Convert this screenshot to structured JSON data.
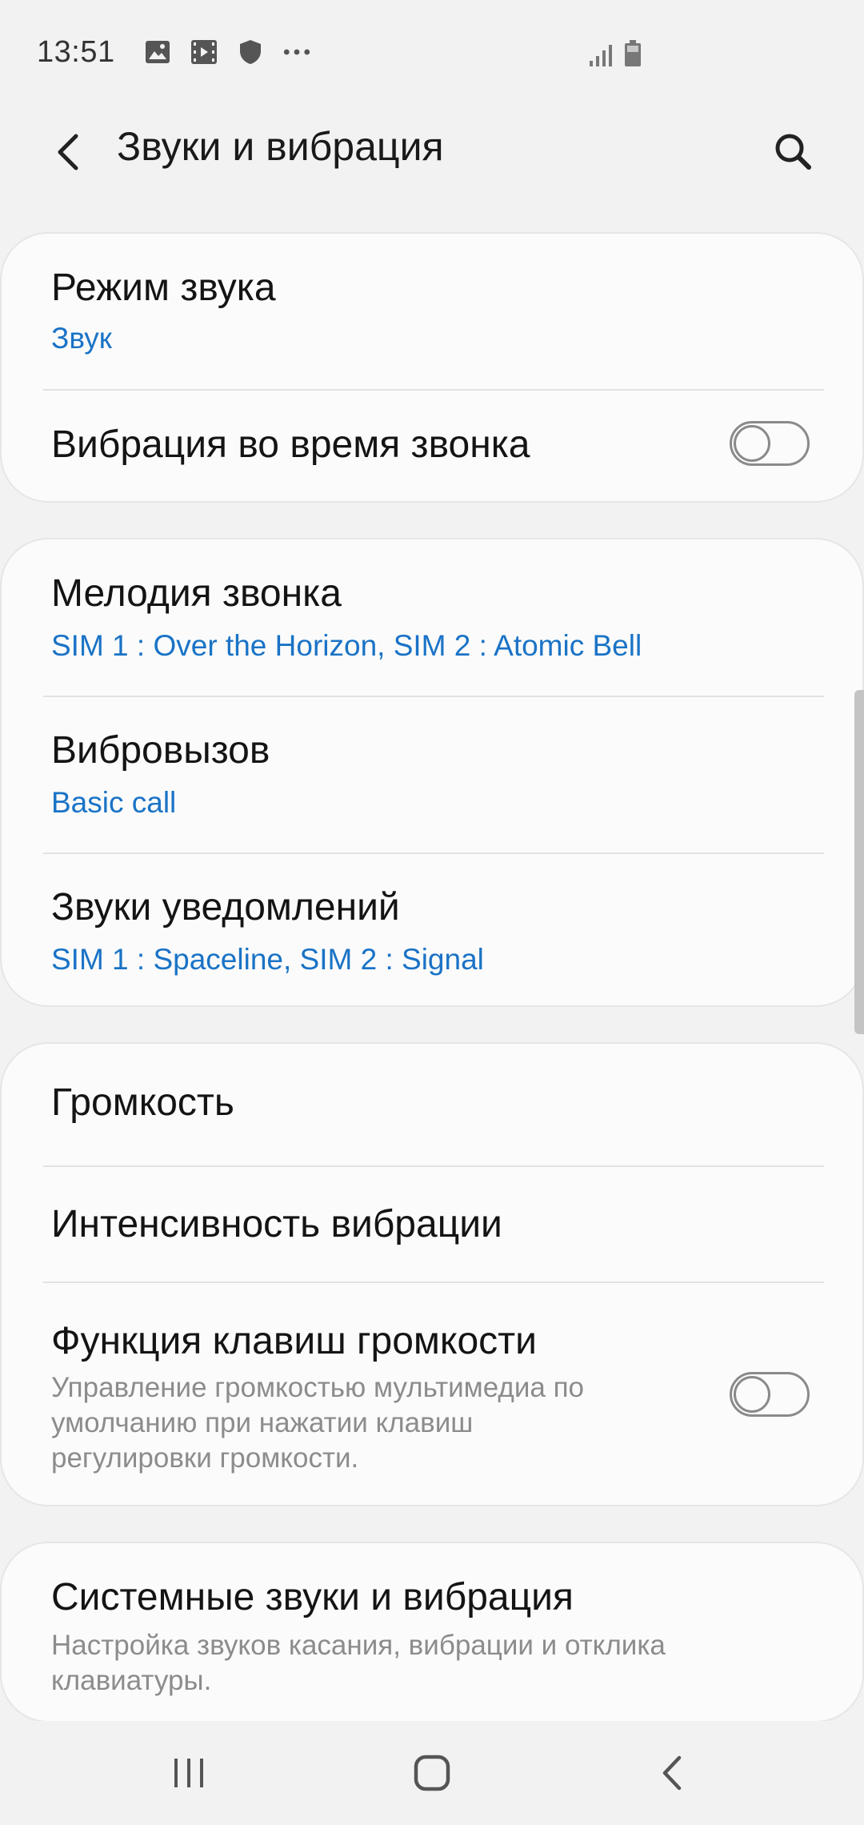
{
  "status_bar": {
    "time": "13:51",
    "icons": [
      "image-icon",
      "video-icon",
      "shield-icon",
      "more-dots-icon"
    ],
    "right_icons": [
      "signal-icon",
      "battery-icon"
    ]
  },
  "app_bar": {
    "title": "Звуки и вибрация",
    "back_icon": "chevron-left-icon",
    "search_icon": "search-icon"
  },
  "accent_colors": {
    "subtitle_blue": "#1a73c6",
    "toggle_off": "#8a8a8a",
    "card_bg": "#fbfbfb",
    "screen_bg": "#f2f2f2"
  },
  "groups": [
    {
      "items": [
        {
          "title": "Режим звука",
          "subtitle": "Звук"
        },
        {
          "title": "Вибрация во время звонка",
          "toggle": false
        }
      ]
    },
    {
      "items": [
        {
          "title": "Мелодия звонка",
          "subtitle": "SIM 1 : Over the Horizon, SIM 2 : Atomic Bell"
        },
        {
          "title": "Вибровызов",
          "subtitle": "Basic call"
        },
        {
          "title": "Звуки уведомлений",
          "subtitle": "SIM 1 : Spaceline, SIM 2 : Signal"
        }
      ]
    },
    {
      "items": [
        {
          "title": "Громкость"
        },
        {
          "title": "Интенсивность вибрации"
        },
        {
          "title": "Функция клавиш громкости",
          "description": "Управление громкостью мультимедиа по умолчанию при нажатии клавиш регулировки громкости.",
          "toggle": false
        }
      ]
    },
    {
      "items": [
        {
          "title": "Системные звуки и вибрация",
          "description": "Настройка звуков касания, вибрации и отклика клавиатуры."
        }
      ]
    }
  ],
  "nav_bar": {
    "buttons": [
      "recent-apps-icon",
      "home-icon",
      "back-icon"
    ]
  }
}
